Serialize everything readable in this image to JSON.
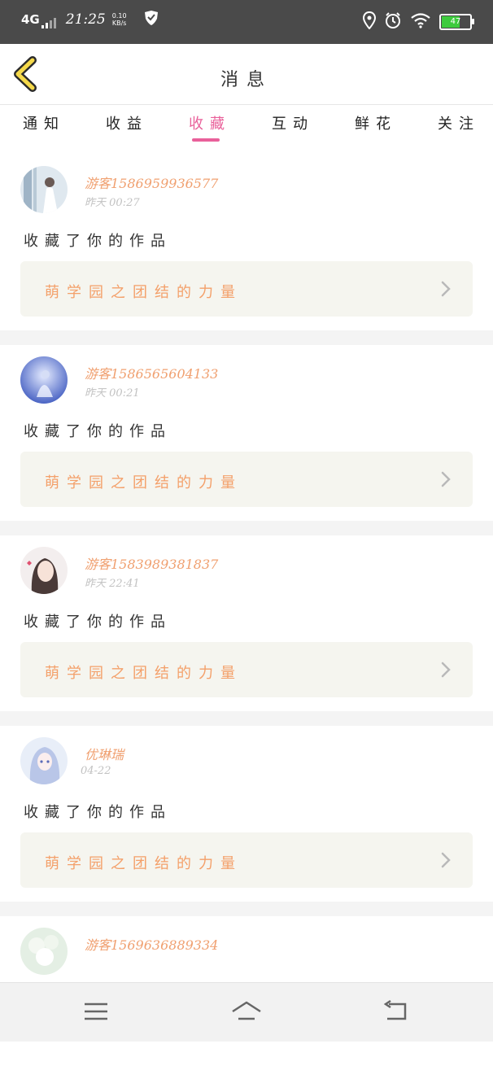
{
  "status_bar": {
    "network": "4G",
    "time": "21:25",
    "speed_value": "0.10",
    "speed_unit": "KB/s",
    "battery": "47",
    "icons": [
      "shield-icon",
      "location-icon",
      "alarm-icon",
      "wifi-icon",
      "battery-icon"
    ]
  },
  "header": {
    "title": "消息"
  },
  "tabs": [
    {
      "label": "通知"
    },
    {
      "label": "收益"
    },
    {
      "label": "收藏",
      "active": true
    },
    {
      "label": "互动"
    },
    {
      "label": "鲜花"
    },
    {
      "label": "关注"
    }
  ],
  "feed": [
    {
      "name": "游客1586959936577",
      "time": "00:27",
      "prefix": "昨天",
      "action": "收藏了你的作品",
      "work_title": "萌学园之团结的力量",
      "avatar": "girl-white-dress"
    },
    {
      "name": "游客1586565604133",
      "time": "00:21",
      "prefix": "昨天",
      "action": "收藏了你的作品",
      "work_title": "萌学园之团结的力量",
      "avatar": "blue-fantasy"
    },
    {
      "name": "游客1583989381837",
      "time": "22:41",
      "prefix": "昨天",
      "action": "收藏了你的作品",
      "work_title": "萌学园之团结的力量",
      "avatar": "anime-girl-dark-hair"
    },
    {
      "name": "优琳瑞",
      "time": "04-22",
      "action": "收藏了你的作品",
      "work_title": "萌学园之团结的力量",
      "avatar": "anime-girl-blue-hair"
    },
    {
      "name": "游客1569636889334",
      "avatar": "flowers"
    }
  ],
  "colors": {
    "accent_pink": "#e9609a",
    "name_orange": "#f0a070",
    "card_bg": "#f5f5ef",
    "status_bar": "#4a4a4a"
  }
}
